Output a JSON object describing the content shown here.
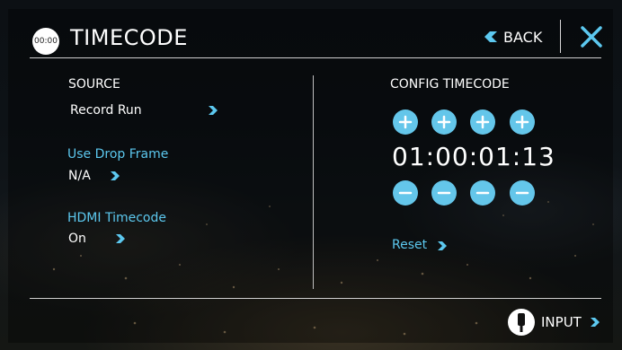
{
  "header": {
    "clock_badge": "00:00",
    "title": "TIMECODE",
    "back_label": "BACK",
    "close_icon": "close-icon"
  },
  "source": {
    "label": "SOURCE",
    "value": "Record Run"
  },
  "drop_frame": {
    "label": "Use Drop Frame",
    "value": "N/A"
  },
  "hdmi_timecode": {
    "label": "HDMI Timecode",
    "value": "On"
  },
  "config": {
    "title": "CONFIG TIMECODE",
    "timecode": "01:00:01:13",
    "reset_label": "Reset"
  },
  "footer": {
    "input_label": "INPUT"
  },
  "colors": {
    "accent": "#5cc8ef",
    "button": "#64c6ea",
    "text": "#ffffff"
  }
}
